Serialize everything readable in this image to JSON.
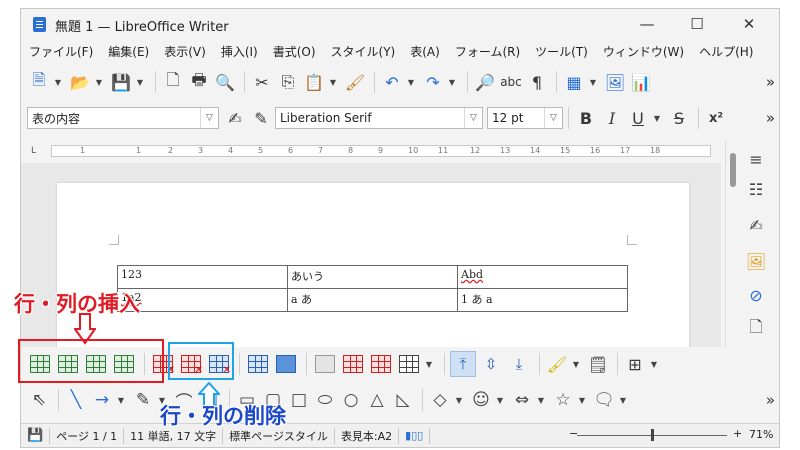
{
  "window": {
    "title": "無題 1 — LibreOffice Writer",
    "minimize_glyph": "—",
    "maximize_glyph": "☐",
    "close_glyph": "✕"
  },
  "menu": [
    "ファイル(F)",
    "編集(E)",
    "表示(V)",
    "挿入(I)",
    "書式(O)",
    "スタイル(Y)",
    "表(A)",
    "フォーム(R)",
    "ツール(T)",
    "ウィンドウ(W)",
    "ヘルプ(H)"
  ],
  "formatting": {
    "paragraph_style": "表の内容",
    "font_name": "Liberation Serif",
    "font_size": "12 pt",
    "bold": "B",
    "italic": "I",
    "underline": "U",
    "strike": "S",
    "superscript": "x²"
  },
  "standard_toolbar": {
    "spellcheck": "abc",
    "pilcrow": "¶",
    "more": "»"
  },
  "ruler": {
    "corner": "L",
    "ticks": [
      "1",
      "1",
      "2",
      "3",
      "4",
      "5",
      "6",
      "7",
      "8",
      "9",
      "10",
      "11",
      "12",
      "13",
      "14",
      "15",
      "16",
      "17",
      "18"
    ]
  },
  "document_table": {
    "rows": [
      [
        "123",
        "あいう",
        "Abd"
      ],
      [
        "1a2",
        "a あ",
        "1 あ a"
      ]
    ]
  },
  "status": {
    "page": "ページ 1 / 1",
    "words": "11 単語, 17 文字",
    "page_style": "標準ページスタイル",
    "table_cell": "表見本:A2",
    "zoom_minus": "−",
    "zoom_plus": "+",
    "zoom": "71%"
  },
  "annotations": {
    "insert_label": "行・列の挿入",
    "delete_label": "行・列の削除",
    "insert_color": "#e01b24",
    "delete_color": "#1ea3e6"
  }
}
